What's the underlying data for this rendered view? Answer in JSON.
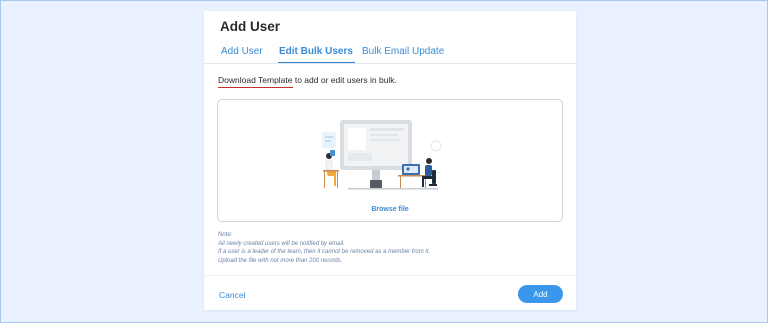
{
  "modal": {
    "title": "Add User",
    "tabs": [
      {
        "label": "Add User",
        "active": false
      },
      {
        "label": "Edit Bulk Users",
        "active": true
      },
      {
        "label": "Bulk Email Update",
        "active": false
      }
    ],
    "intro": {
      "link_text": "Download Template",
      "rest_text": " to add or edit users in bulk."
    },
    "dropzone": {
      "browse_label": "Browse file"
    },
    "notes": [
      "Note:",
      "All newly created users will be notified by email.",
      "If a user is a leader of the team, then it cannot be removed as a member from it.",
      "Upload the file with not more than 200 records."
    ],
    "footer": {
      "cancel_label": "Cancel",
      "add_label": "Add"
    }
  },
  "colors": {
    "accent": "#3a97ec",
    "link": "#3a8ad6",
    "page_bg": "#e8f1fd",
    "underline_red": "#c33030"
  }
}
